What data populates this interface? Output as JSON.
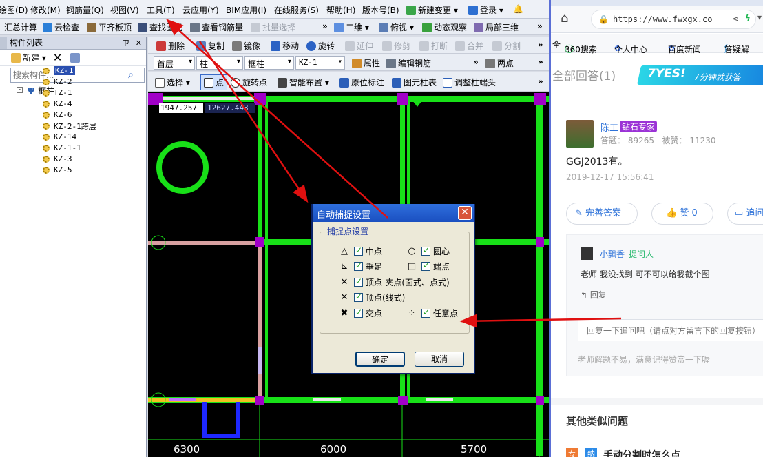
{
  "menubar": {
    "items": [
      "绘图(D)",
      "修改(M)",
      "钢筋量(Q)",
      "视图(V)",
      "工具(T)",
      "云应用(Y)",
      "BIM应用(I)",
      "在线服务(S)",
      "帮助(H)",
      "版本号(B)",
      "新建变更",
      "登录"
    ]
  },
  "toolbar1": {
    "items": [
      "汇总计算",
      "云检查",
      "平齐板顶",
      "查找图元",
      "查看钢筋量",
      "批量选择"
    ],
    "view_mode": "二维",
    "view_angle": "俯视",
    "dynamic": "动态观察",
    "local3d": "局部三维"
  },
  "panel": {
    "title": "构件列表",
    "pin": "ㄗ",
    "close": "✕",
    "new_label": "新建",
    "search_placeholder": "搜索构件...",
    "tree_root": "框柱",
    "tree_items": [
      "KZ-1",
      "KZ-2",
      "TZ-1",
      "KZ-4",
      "KZ-6",
      "KZ-2-1跨层",
      "KZ-14",
      "KZ-1-1",
      "KZ-3",
      "KZ-5"
    ]
  },
  "toolbar2": {
    "items": [
      "删除",
      "复制",
      "镜像",
      "移动",
      "旋转",
      "延伸",
      "修剪",
      "打断",
      "合并",
      "分割"
    ]
  },
  "toolbar3": {
    "floor": "首层",
    "category": "柱",
    "type": "框柱",
    "component": "KZ-1",
    "attr": "属性",
    "edit_rebar": "编辑钢筋",
    "two_points": "两点"
  },
  "toolbar4": {
    "items": [
      "选择",
      "点",
      "旋转点",
      "智能布置",
      "原位标注",
      "图元柱表",
      "调整柱端头"
    ]
  },
  "canvas": {
    "coord_x": "1947.257",
    "coord_y": "12627.443",
    "dims": [
      "6300",
      "6000",
      "5700"
    ]
  },
  "dialog": {
    "title": "自动捕捉设置",
    "close": "✕",
    "group_label": "捕捉点设置",
    "options": [
      {
        "symbol": "△",
        "label": "中点",
        "checked": true
      },
      {
        "symbol": "○",
        "label": "圆心",
        "checked": true
      },
      {
        "symbol": "⊾",
        "label": "垂足",
        "checked": true
      },
      {
        "symbol": "□",
        "label": "端点",
        "checked": true
      },
      {
        "symbol": "✕",
        "label": "顶点-夹点(面式、点式)",
        "checked": true
      },
      {
        "symbol": "✕",
        "label": "顶点(线式)",
        "checked": true
      },
      {
        "symbol": "✖",
        "label": "交点",
        "checked": true
      },
      {
        "symbol": "⁘",
        "label": "任意点",
        "checked": true
      }
    ],
    "ok": "确定",
    "cancel": "取消"
  },
  "browser": {
    "url": "https://www.fwxgx.co",
    "bookmarks": [
      "全",
      "360搜索",
      "个人中心",
      "百度新闻",
      "答疑解"
    ],
    "answers_header": "全部回答(1)",
    "promo_big": "7YES!",
    "promo_small": "7分钟就获答",
    "answer": {
      "author": "陈工",
      "badge": "钻石专家",
      "answers_label": "答题：",
      "answers_count": "89265",
      "likes_label": "被赞：",
      "likes_count": "11230",
      "text": "GGJ2013有。",
      "time": "2019-12-17 15:56:41"
    },
    "buttons": {
      "improve": "完善答案",
      "like": "赞 0",
      "follow": "追问"
    },
    "followup": {
      "user": "小飘香",
      "role": "提问人",
      "text": "老师 我没找到 可不可以给我截个图",
      "reply": "回复",
      "input_placeholder": "回复一下追问吧（请点对方留言下的回复按钮）",
      "thanks": "老师解题不易，满意记得赞赏一下喔"
    },
    "similar_header": "其他类似问题",
    "similar_tags": [
      "专",
      "纳"
    ],
    "similar_item": "手动分割时怎么点"
  },
  "colors": {
    "beam_green": "#18e018",
    "column_purple": "#a100c8",
    "arrow_red": "#e01010",
    "canvas_bg": "#000000",
    "dialog_title": "#2a61d6"
  }
}
